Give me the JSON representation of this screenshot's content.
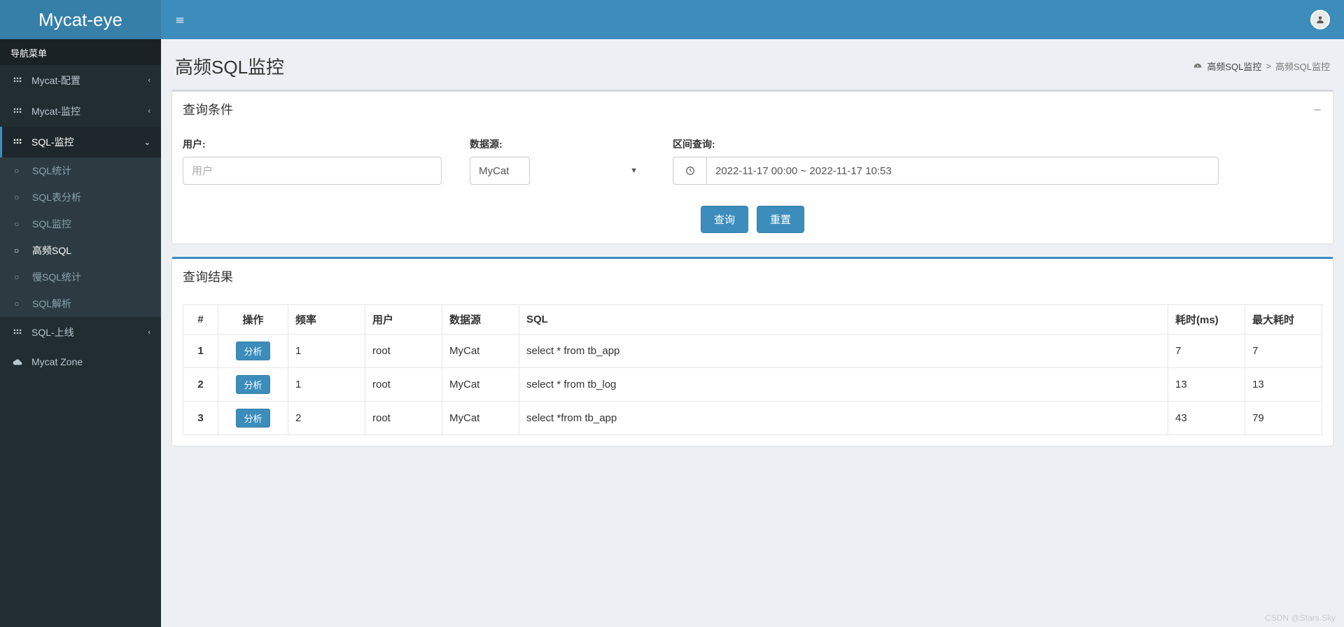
{
  "app": {
    "name": "Mycat-eye"
  },
  "sidebar": {
    "header": "导航菜单",
    "items": [
      {
        "label": "Mycat-配置",
        "expandable": true
      },
      {
        "label": "Mycat-监控",
        "expandable": true
      },
      {
        "label": "SQL-监控",
        "expandable": true,
        "open": true
      },
      {
        "label": "SQL-上线",
        "expandable": true
      },
      {
        "label": "Mycat Zone",
        "expandable": false
      }
    ],
    "sqlMonitorChildren": [
      {
        "label": "SQL统计",
        "active": false
      },
      {
        "label": "SQL表分析",
        "active": false
      },
      {
        "label": "SQL监控",
        "active": false
      },
      {
        "label": "高频SQL",
        "active": true
      },
      {
        "label": "慢SQL统计",
        "active": false
      },
      {
        "label": "SQL解析",
        "active": false
      }
    ]
  },
  "page": {
    "title": "高频SQL监控",
    "breadcrumb": {
      "root": "高频SQL监控",
      "sep": ">",
      "leaf": "高频SQL监控"
    }
  },
  "filter": {
    "panelTitle": "查询条件",
    "user": {
      "label": "用户:",
      "placeholder": "用户",
      "value": ""
    },
    "datasource": {
      "label": "数据源:",
      "value": "MyCat"
    },
    "range": {
      "label": "区间查询:",
      "value": "2022-11-17 00:00 ~ 2022-11-17 10:53"
    },
    "buttons": {
      "query": "查询",
      "reset": "重置"
    }
  },
  "results": {
    "panelTitle": "查询结果",
    "header": {
      "idx": "#",
      "op": "操作",
      "freq": "频率",
      "user": "用户",
      "ds": "数据源",
      "sql": "SQL",
      "time": "耗时(ms)",
      "maxtime": "最大耗时"
    },
    "opButton": "分析",
    "rows": [
      {
        "idx": "1",
        "freq": "1",
        "user": "root",
        "ds": "MyCat",
        "sql": "select * from tb_app",
        "time": "7",
        "maxtime": "7"
      },
      {
        "idx": "2",
        "freq": "1",
        "user": "root",
        "ds": "MyCat",
        "sql": "select * from tb_log",
        "time": "13",
        "maxtime": "13"
      },
      {
        "idx": "3",
        "freq": "2",
        "user": "root",
        "ds": "MyCat",
        "sql": "select *from tb_app",
        "time": "43",
        "maxtime": "79"
      }
    ]
  },
  "watermark": "CSDN @Stars.Sky"
}
